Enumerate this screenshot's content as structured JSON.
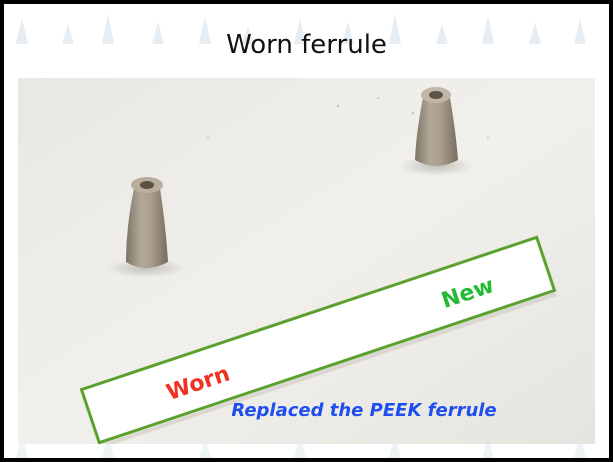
{
  "slide": {
    "title": "Worn ferrule",
    "caption": "Replaced the PEEK ferrule"
  },
  "photo": {
    "objects": [
      {
        "name": "worn-ferrule",
        "label": "Worn",
        "label_color": "#ee3322"
      },
      {
        "name": "new-ferrule",
        "label": "New",
        "label_color": "#22bb33"
      }
    ],
    "banner_border_color": "#5aa12f"
  },
  "colors": {
    "frame": "#000000",
    "caption": "#1f4ef0",
    "ferrule": "#a69b8c"
  }
}
